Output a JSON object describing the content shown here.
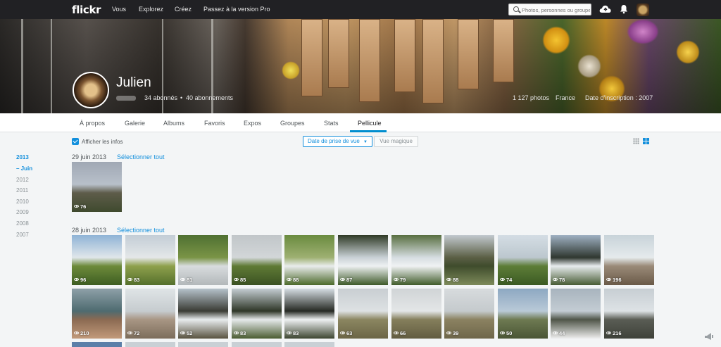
{
  "nav": {
    "logo": "flickr",
    "links": [
      "Vous",
      "Explorez",
      "Créez",
      "Passez à la version Pro"
    ],
    "search_placeholder": "Photos, personnes ou groupes"
  },
  "profile": {
    "name": "Julien",
    "followers": "34 abonnés",
    "following": "40 abonnements",
    "photos": "1 127 photos",
    "country": "France",
    "joined": "Date d'inscription : 2007"
  },
  "tabs": [
    "À propos",
    "Galerie",
    "Albums",
    "Favoris",
    "Expos",
    "Groupes",
    "Stats",
    "Pellicule"
  ],
  "active_tab": "Pellicule",
  "toolbar": {
    "show_info_label": "Afficher les infos",
    "sort_label": "Date de prise de vue",
    "magic_view_label": "Vue magique"
  },
  "years": [
    "2013",
    "– Juin",
    "2012",
    "2011",
    "2010",
    "2009",
    "2008",
    "2007"
  ],
  "sections": [
    {
      "date": "29 juin 2013",
      "select_all": "Sélectionner tout",
      "photos": [
        {
          "views": "76",
          "colors": [
            "#a0a8b4",
            "#b8c0ca",
            "#5e5c4a",
            "#3f4a2e"
          ]
        }
      ]
    },
    {
      "date": "28 juin 2013",
      "select_all": "Sélectionner tout",
      "photos": [
        {
          "views": "96",
          "colors": [
            "#8fb3d6",
            "#e0e6ea",
            "#6d8a3a",
            "#3e5e22"
          ]
        },
        {
          "views": "83",
          "colors": [
            "#c3cdd6",
            "#e4e7e8",
            "#8ea04c",
            "#55702c"
          ]
        },
        {
          "views": "81",
          "colors": [
            "#4f7032",
            "#7a9446",
            "#d8dcde",
            "#b3b8ba"
          ]
        },
        {
          "views": "85",
          "colors": [
            "#c1c6c9",
            "#d2d6d8",
            "#5f7a35",
            "#3b5222"
          ]
        },
        {
          "views": "88",
          "colors": [
            "#6a8b3f",
            "#9eb072",
            "#e9ecec",
            "#4c6a2a"
          ]
        },
        {
          "views": "87",
          "colors": [
            "#2f3a26",
            "#c9d1d6",
            "#eef1f2",
            "#3e5a29"
          ]
        },
        {
          "views": "79",
          "colors": [
            "#586f40",
            "#d6dde1",
            "#f0f2f3",
            "#405c2a"
          ]
        },
        {
          "views": "88",
          "colors": [
            "#c2c9cf",
            "#5b5f45",
            "#3f4c2c",
            "#7d8a5a"
          ]
        },
        {
          "views": "74",
          "colors": [
            "#d4dde4",
            "#bcc7ce",
            "#5d7d37",
            "#3b5a23"
          ]
        },
        {
          "views": "78",
          "colors": [
            "#9fb1c3",
            "#2f3730",
            "#e7ecee",
            "#485c34"
          ]
        },
        {
          "views": "196",
          "colors": [
            "#c8d3d9",
            "#e5eaec",
            "#9a8a78",
            "#6a5a48"
          ]
        }
      ]
    },
    {
      "date": "",
      "select_all": "",
      "photos": [
        {
          "views": "210",
          "colors": [
            "#8ea0a8",
            "#4e6b70",
            "#8b6a52",
            "#c29a7a"
          ]
        },
        {
          "views": "72",
          "colors": [
            "#dfe4e6",
            "#c6cccf",
            "#a89684",
            "#7c6d5b"
          ]
        },
        {
          "views": "52",
          "colors": [
            "#b6c2cb",
            "#3a3c35",
            "#e8ecee",
            "#58523f"
          ]
        },
        {
          "views": "83",
          "colors": [
            "#c4cdd2",
            "#2f3728",
            "#e6eaeb",
            "#4a5c31"
          ]
        },
        {
          "views": "83",
          "colors": [
            "#d5dde3",
            "#262a24",
            "#eef1f2",
            "#3c4530"
          ]
        },
        {
          "views": "63",
          "colors": [
            "#c9ced2",
            "#dde1e3",
            "#8b8661",
            "#6b6546"
          ]
        },
        {
          "views": "66",
          "colors": [
            "#d0d4d6",
            "#e3e6e7",
            "#857f5c",
            "#625c41"
          ]
        },
        {
          "views": "39",
          "colors": [
            "#d7dbdd",
            "#c5cacd",
            "#8b8261",
            "#6e664a"
          ]
        },
        {
          "views": "50",
          "colors": [
            "#8da8c2",
            "#b9c9d7",
            "#6e7a52",
            "#4a5535"
          ]
        },
        {
          "views": "44",
          "colors": [
            "#a8b4be",
            "#c3ccd3",
            "#4f5548",
            "#eeeeee"
          ]
        },
        {
          "views": "216",
          "colors": [
            "#c7ced3",
            "#dde2e5",
            "#5a5d55",
            "#3e423a"
          ]
        }
      ]
    }
  ]
}
